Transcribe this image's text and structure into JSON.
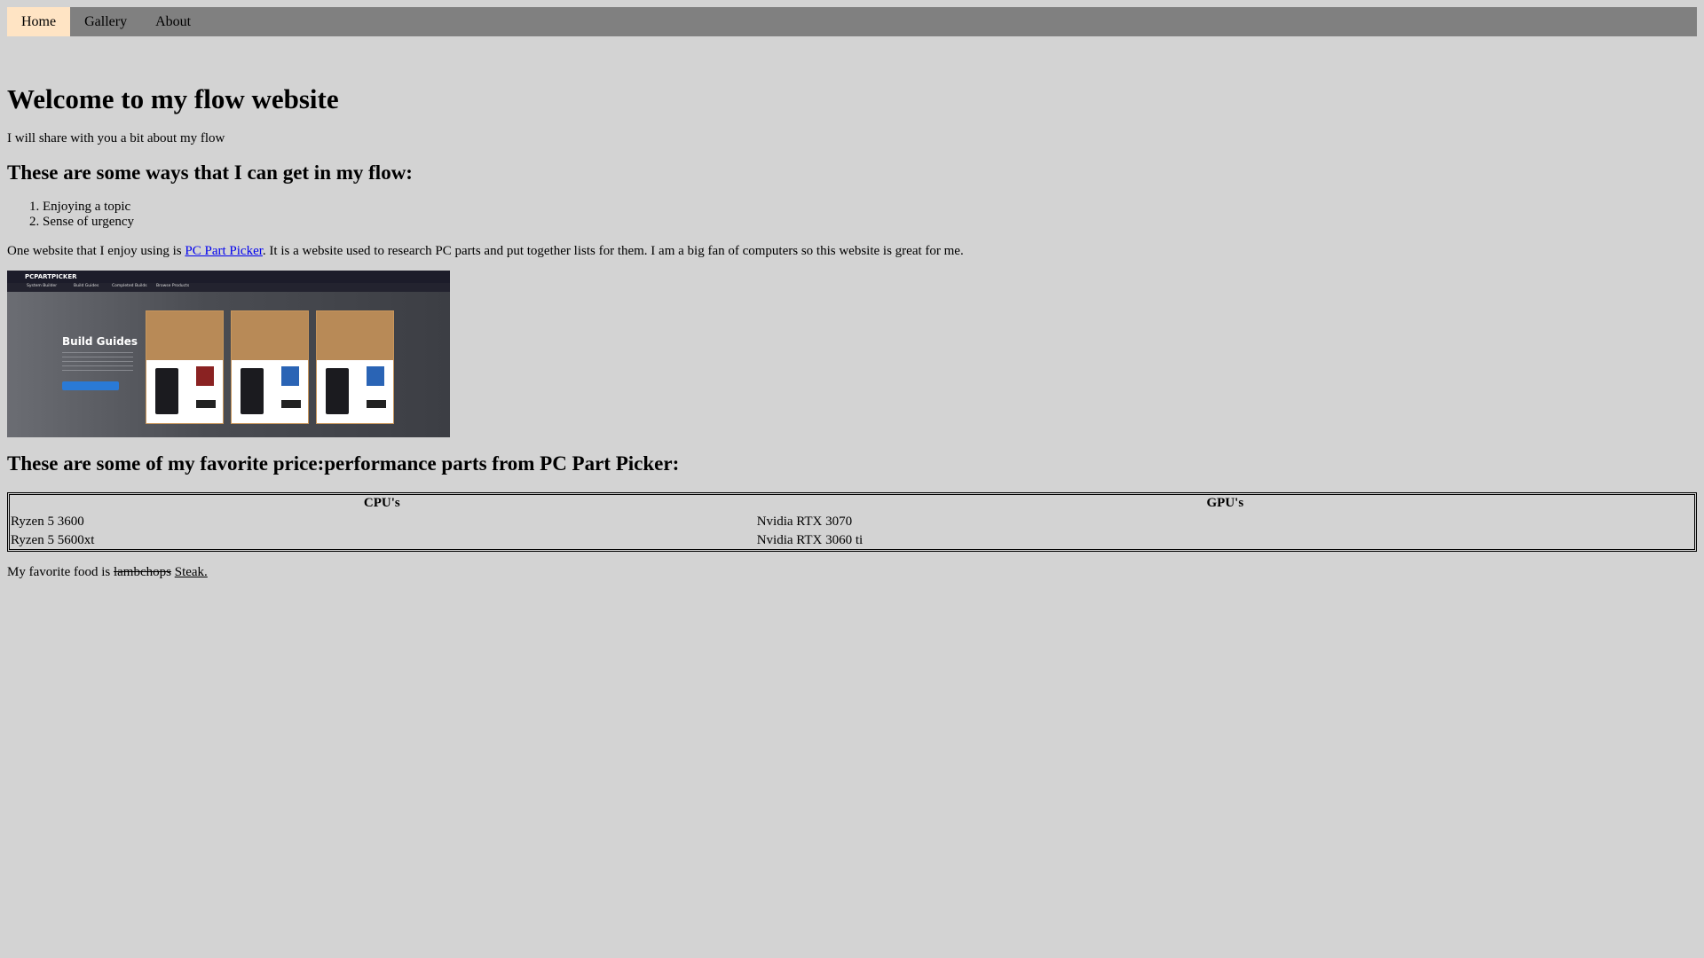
{
  "nav": {
    "items": [
      {
        "label": "Home",
        "active": true
      },
      {
        "label": "Gallery",
        "active": false
      },
      {
        "label": "About",
        "active": false
      }
    ]
  },
  "main": {
    "title": "Welcome to my flow website",
    "intro": "I will share with you a bit about my flow",
    "ways_heading": "These are some ways that I can get in my flow:",
    "ways": [
      "Enjoying a topic",
      "Sense of urgency"
    ],
    "website_para_before": "One website that I enjoy using is ",
    "website_link": "PC Part Picker",
    "website_para_after": ". It is a website used to research PC parts and put together lists for them. I am a big fan of computers so this website is great for me.",
    "image": {
      "logo": "PCPARTPICKER",
      "heading": "Build Guides",
      "nav": [
        "System Builder",
        "Build Guides",
        "Completed Builds",
        "Browse Products"
      ]
    },
    "parts_heading": "These are some of my favorite price:performance parts from PC Part Picker:",
    "table": {
      "headers": [
        "CPU's",
        "GPU's"
      ],
      "rows": [
        [
          "Ryzen 5 3600",
          "Nvidia RTX 3070"
        ],
        [
          "Ryzen 5 5600xt",
          "Nvidia RTX 3060 ti"
        ]
      ]
    },
    "food_before": "My favorite food is ",
    "food_struck": "lambchops",
    "food_after": "Steak."
  },
  "colors": {
    "background": "#d3d3d3",
    "nav_bar": "#808080",
    "nav_active": "#ffe4c4",
    "link": "#0000ee"
  }
}
